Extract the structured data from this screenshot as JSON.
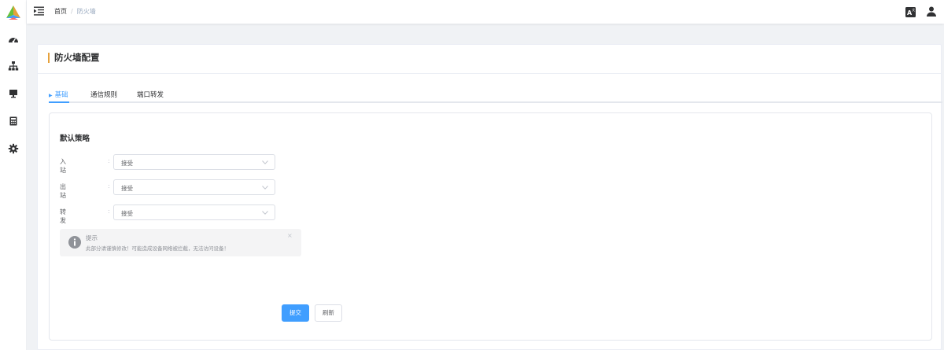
{
  "breadcrumb": {
    "home": "首页",
    "separator": "/",
    "current": "防火墙"
  },
  "sidebar": {
    "items": [
      {
        "icon": "dashboard-icon"
      },
      {
        "icon": "network-topology-icon"
      },
      {
        "icon": "monitor-icon"
      },
      {
        "icon": "calculator-icon"
      },
      {
        "icon": "gear-icon"
      }
    ]
  },
  "card": {
    "title": "防火墙配置"
  },
  "tabs": [
    {
      "label": "基础",
      "active": true
    },
    {
      "label": "通信规则",
      "active": false
    },
    {
      "label": "端口转发",
      "active": false
    }
  ],
  "form": {
    "section_title": "默认策略",
    "colon": ":",
    "fields": [
      {
        "label": "入站",
        "value": "接受"
      },
      {
        "label": "出站",
        "value": "接受"
      },
      {
        "label": "转发",
        "value": "接受"
      }
    ]
  },
  "alert": {
    "title": "提示",
    "description": "此部分请谨慎修改！可能造成设备网络被拦截，无法访问设备！",
    "close": "×"
  },
  "buttons": {
    "submit": "提交",
    "refresh": "刷新"
  },
  "colors": {
    "primary": "#409eff",
    "accent": "#e6a23c",
    "background": "#f0f2f5"
  }
}
